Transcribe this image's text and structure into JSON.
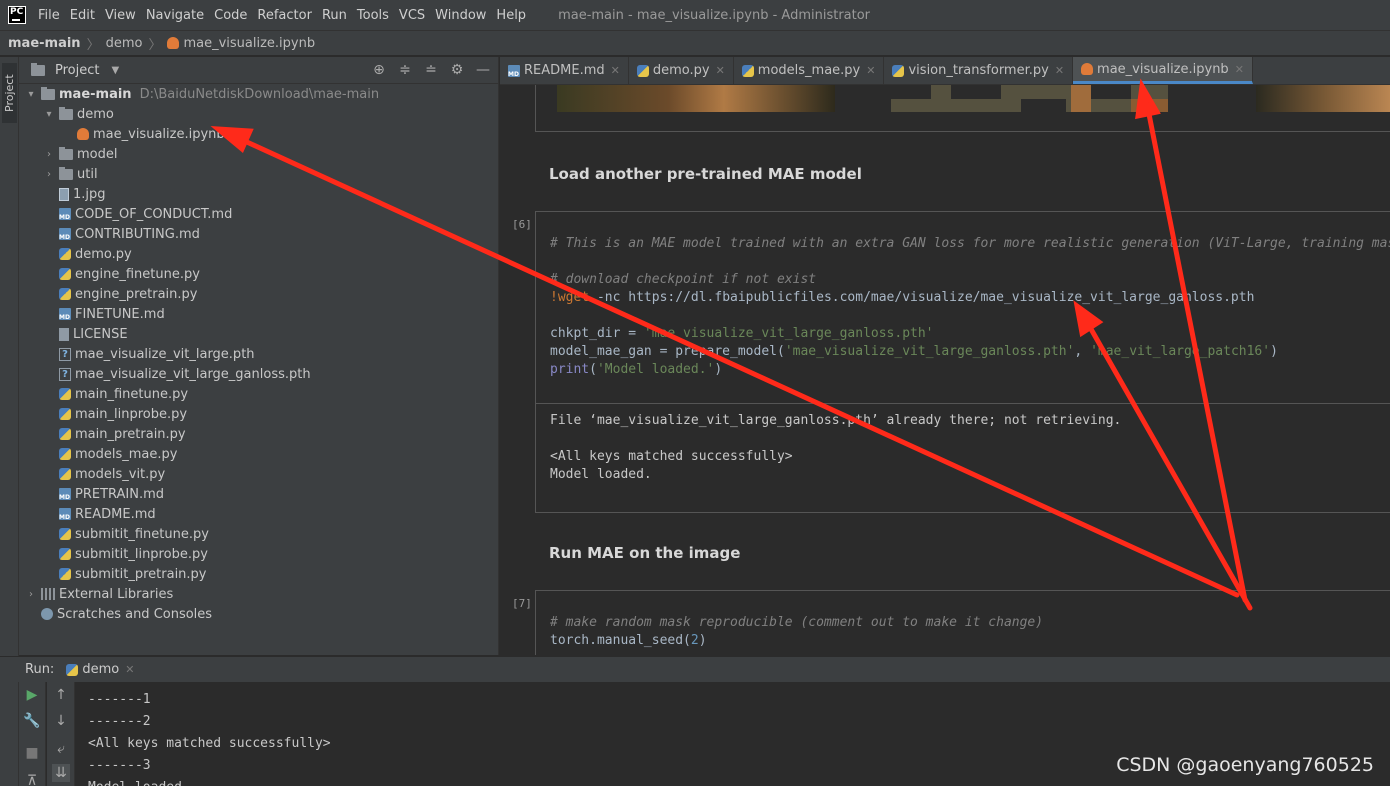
{
  "menubar": {
    "logo_text": "PC",
    "items": [
      "File",
      "Edit",
      "View",
      "Navigate",
      "Code",
      "Refactor",
      "Run",
      "Tools",
      "VCS",
      "Window",
      "Help"
    ],
    "window_title": "mae-main - mae_visualize.ipynb - Administrator"
  },
  "breadcrumb": {
    "root": "mae-main",
    "folder": "demo",
    "file": "mae_visualize.ipynb"
  },
  "left_strip": {
    "project_tab": "Project"
  },
  "project_panel": {
    "title": "Project",
    "tree": [
      {
        "label": "mae-main",
        "path": "D:\\BaiduNetdiskDownload\\mae-main",
        "icon": "folder-icon",
        "arrow": "▾",
        "indent": 0,
        "bold": true
      },
      {
        "label": "demo",
        "icon": "folder-icon",
        "arrow": "▾",
        "indent": 1
      },
      {
        "label": "mae_visualize.ipynb",
        "icon": "ipynb-file-icon",
        "arrow": "",
        "indent": 2
      },
      {
        "label": "model",
        "icon": "folder-icon",
        "arrow": "›",
        "indent": 1
      },
      {
        "label": "util",
        "icon": "folder-icon",
        "arrow": "›",
        "indent": 1
      },
      {
        "label": "1.jpg",
        "icon": "jpg-file-icon",
        "arrow": "",
        "indent": 1
      },
      {
        "label": "CODE_OF_CONDUCT.md",
        "icon": "md-file-icon",
        "arrow": "",
        "indent": 1
      },
      {
        "label": "CONTRIBUTING.md",
        "icon": "md-file-icon",
        "arrow": "",
        "indent": 1
      },
      {
        "label": "demo.py",
        "icon": "python-file-icon",
        "arrow": "",
        "indent": 1
      },
      {
        "label": "engine_finetune.py",
        "icon": "python-file-icon",
        "arrow": "",
        "indent": 1
      },
      {
        "label": "engine_pretrain.py",
        "icon": "python-file-icon",
        "arrow": "",
        "indent": 1
      },
      {
        "label": "FINETUNE.md",
        "icon": "md-file-icon",
        "arrow": "",
        "indent": 1
      },
      {
        "label": "LICENSE",
        "icon": "text-file-icon",
        "arrow": "",
        "indent": 1
      },
      {
        "label": "mae_visualize_vit_large.pth",
        "icon": "unknown-file-icon",
        "arrow": "",
        "indent": 1
      },
      {
        "label": "mae_visualize_vit_large_ganloss.pth",
        "icon": "unknown-file-icon",
        "arrow": "",
        "indent": 1
      },
      {
        "label": "main_finetune.py",
        "icon": "python-file-icon",
        "arrow": "",
        "indent": 1
      },
      {
        "label": "main_linprobe.py",
        "icon": "python-file-icon",
        "arrow": "",
        "indent": 1
      },
      {
        "label": "main_pretrain.py",
        "icon": "python-file-icon",
        "arrow": "",
        "indent": 1
      },
      {
        "label": "models_mae.py",
        "icon": "python-file-icon",
        "arrow": "",
        "indent": 1
      },
      {
        "label": "models_vit.py",
        "icon": "python-file-icon",
        "arrow": "",
        "indent": 1
      },
      {
        "label": "PRETRAIN.md",
        "icon": "md-file-icon",
        "arrow": "",
        "indent": 1
      },
      {
        "label": "README.md",
        "icon": "md-file-icon",
        "arrow": "",
        "indent": 1
      },
      {
        "label": "submitit_finetune.py",
        "icon": "python-file-icon",
        "arrow": "",
        "indent": 1
      },
      {
        "label": "submitit_linprobe.py",
        "icon": "python-file-icon",
        "arrow": "",
        "indent": 1
      },
      {
        "label": "submitit_pretrain.py",
        "icon": "python-file-icon",
        "arrow": "",
        "indent": 1
      },
      {
        "label": "External Libraries",
        "icon": "library-icon",
        "arrow": "›",
        "indent": 0
      },
      {
        "label": "Scratches and Consoles",
        "icon": "scratch-icon",
        "arrow": "",
        "indent": 0
      }
    ]
  },
  "editor_tabs": [
    {
      "label": "README.md",
      "icon": "md-file-icon",
      "active": false
    },
    {
      "label": "demo.py",
      "icon": "python-file-icon",
      "active": false
    },
    {
      "label": "models_mae.py",
      "icon": "python-file-icon",
      "active": false
    },
    {
      "label": "vision_transformer.py",
      "icon": "python-file-icon",
      "active": false
    },
    {
      "label": "mae_visualize.ipynb",
      "icon": "ipynb-file-icon",
      "active": true
    }
  ],
  "notebook": {
    "heading_1": "Load another pre-trained MAE model",
    "cell_6": {
      "exec_count": "[6]",
      "comment_1": "# This is an MAE model trained with an extra GAN loss for more realistic generation (ViT-Large, training mas",
      "comment_2": "# download checkpoint if not exist",
      "wget_bang": "!wget",
      "wget_rest": " -nc https://dl.fbaipublicfiles.com/mae/visualize/mae_visualize_vit_large_ganloss.pth",
      "chkpt_var": "chkpt_dir = ",
      "chkpt_str": "'mae_visualize_vit_large_ganloss.pth'",
      "model_var": "model_mae_gan = prepare_model(",
      "model_str1": "'mae_visualize_vit_large_ganloss.pth'",
      "model_comma": ", ",
      "model_str2": "'mae_vit_large_patch16'",
      "model_close": ")",
      "print_kw": "print",
      "print_open": "(",
      "print_str": "'Model loaded.'",
      "print_close": ")",
      "output_1": "File ‘mae_visualize_vit_large_ganloss.pth’ already there; not retrieving.",
      "output_2": "<All keys matched successfully>",
      "output_3": "Model loaded."
    },
    "heading_2": "Run MAE on the image",
    "cell_7": {
      "exec_count": "[7]",
      "comment_1": "# make random mask reproducible (comment out to make it change)",
      "line_2_code": "torch.manual_seed(",
      "line_2_num": "2",
      "line_2_close": ")"
    }
  },
  "run_panel": {
    "label": "Run:",
    "tab": "demo",
    "console_lines": [
      "-------1",
      "-------2",
      "<All keys matched successfully>",
      "-------3",
      "Model loaded."
    ]
  },
  "watermark": "CSDN @gaoenyang760525",
  "colors": {
    "background": "#2b2b2b",
    "panel": "#3c3f41",
    "active_tab_underline": "#4a88c7",
    "annotation_arrow": "#ff2a1a"
  }
}
